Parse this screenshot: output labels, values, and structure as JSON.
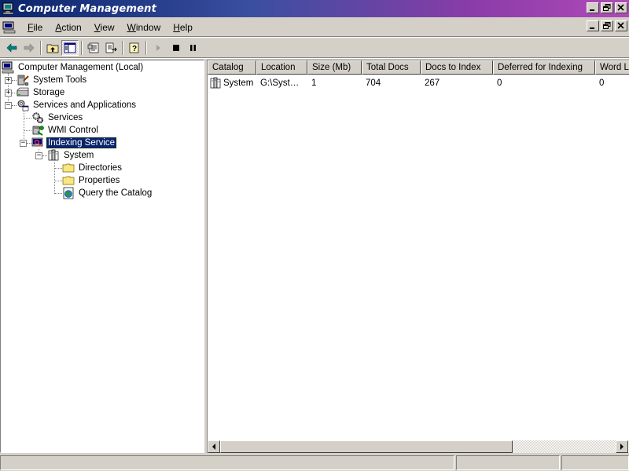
{
  "window": {
    "title": "Computer Management",
    "caption_buttons": [
      "minimize",
      "restore",
      "close"
    ]
  },
  "menubar": {
    "items": [
      {
        "label": "File",
        "accel": "F"
      },
      {
        "label": "Action",
        "accel": "A"
      },
      {
        "label": "View",
        "accel": "V"
      },
      {
        "label": "Window",
        "accel": "W"
      },
      {
        "label": "Help",
        "accel": "H"
      }
    ]
  },
  "toolbar": {
    "buttons": [
      "back-icon",
      "forward-icon",
      "up-folder-icon",
      "show-hide-tree-icon",
      "properties-icon",
      "export-list-icon",
      "help-icon",
      "play-icon",
      "stop-icon",
      "pause-icon"
    ]
  },
  "tree": {
    "root": "Computer Management (Local)",
    "system_tools": "System Tools",
    "storage": "Storage",
    "services_apps": "Services and Applications",
    "services": "Services",
    "wmi": "WMI Control",
    "indexing": "Indexing Service",
    "system": "System",
    "directories": "Directories",
    "properties": "Properties",
    "query": "Query the Catalog"
  },
  "list": {
    "columns": [
      "Catalog",
      "Location",
      "Size (Mb)",
      "Total Docs",
      "Docs to Index",
      "Deferred for Indexing",
      "Word Li"
    ],
    "rows": [
      {
        "catalog": "System",
        "location": "G:\\Syst…",
        "size": "1",
        "total_docs": "704",
        "docs_to_index": "267",
        "deferred": "0",
        "word_lists": "0"
      }
    ]
  },
  "colors": {
    "title_start": "#0a246a",
    "title_end": "#b04ab8",
    "face": "#d4d0c8",
    "selection": "#0a246a"
  }
}
